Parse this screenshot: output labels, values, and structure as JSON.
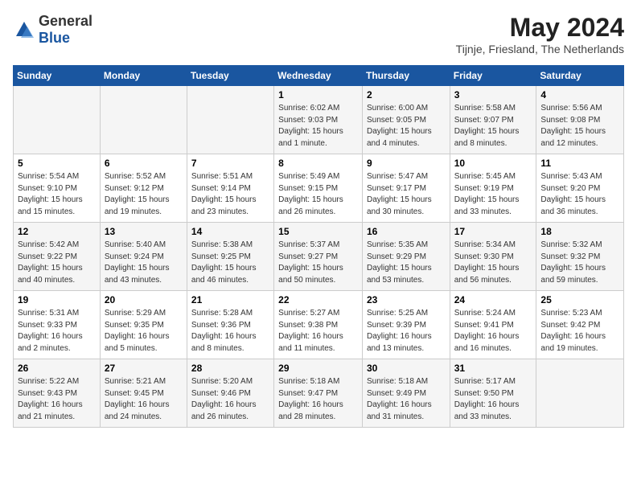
{
  "header": {
    "logo": {
      "general": "General",
      "blue": "Blue"
    },
    "month_year": "May 2024",
    "location": "Tijnje, Friesland, The Netherlands"
  },
  "calendar": {
    "days_of_week": [
      "Sunday",
      "Monday",
      "Tuesday",
      "Wednesday",
      "Thursday",
      "Friday",
      "Saturday"
    ],
    "weeks": [
      [
        {
          "day": "",
          "details": ""
        },
        {
          "day": "",
          "details": ""
        },
        {
          "day": "",
          "details": ""
        },
        {
          "day": "1",
          "details": "Sunrise: 6:02 AM\nSunset: 9:03 PM\nDaylight: 15 hours\nand 1 minute."
        },
        {
          "day": "2",
          "details": "Sunrise: 6:00 AM\nSunset: 9:05 PM\nDaylight: 15 hours\nand 4 minutes."
        },
        {
          "day": "3",
          "details": "Sunrise: 5:58 AM\nSunset: 9:07 PM\nDaylight: 15 hours\nand 8 minutes."
        },
        {
          "day": "4",
          "details": "Sunrise: 5:56 AM\nSunset: 9:08 PM\nDaylight: 15 hours\nand 12 minutes."
        }
      ],
      [
        {
          "day": "5",
          "details": "Sunrise: 5:54 AM\nSunset: 9:10 PM\nDaylight: 15 hours\nand 15 minutes."
        },
        {
          "day": "6",
          "details": "Sunrise: 5:52 AM\nSunset: 9:12 PM\nDaylight: 15 hours\nand 19 minutes."
        },
        {
          "day": "7",
          "details": "Sunrise: 5:51 AM\nSunset: 9:14 PM\nDaylight: 15 hours\nand 23 minutes."
        },
        {
          "day": "8",
          "details": "Sunrise: 5:49 AM\nSunset: 9:15 PM\nDaylight: 15 hours\nand 26 minutes."
        },
        {
          "day": "9",
          "details": "Sunrise: 5:47 AM\nSunset: 9:17 PM\nDaylight: 15 hours\nand 30 minutes."
        },
        {
          "day": "10",
          "details": "Sunrise: 5:45 AM\nSunset: 9:19 PM\nDaylight: 15 hours\nand 33 minutes."
        },
        {
          "day": "11",
          "details": "Sunrise: 5:43 AM\nSunset: 9:20 PM\nDaylight: 15 hours\nand 36 minutes."
        }
      ],
      [
        {
          "day": "12",
          "details": "Sunrise: 5:42 AM\nSunset: 9:22 PM\nDaylight: 15 hours\nand 40 minutes."
        },
        {
          "day": "13",
          "details": "Sunrise: 5:40 AM\nSunset: 9:24 PM\nDaylight: 15 hours\nand 43 minutes."
        },
        {
          "day": "14",
          "details": "Sunrise: 5:38 AM\nSunset: 9:25 PM\nDaylight: 15 hours\nand 46 minutes."
        },
        {
          "day": "15",
          "details": "Sunrise: 5:37 AM\nSunset: 9:27 PM\nDaylight: 15 hours\nand 50 minutes."
        },
        {
          "day": "16",
          "details": "Sunrise: 5:35 AM\nSunset: 9:29 PM\nDaylight: 15 hours\nand 53 minutes."
        },
        {
          "day": "17",
          "details": "Sunrise: 5:34 AM\nSunset: 9:30 PM\nDaylight: 15 hours\nand 56 minutes."
        },
        {
          "day": "18",
          "details": "Sunrise: 5:32 AM\nSunset: 9:32 PM\nDaylight: 15 hours\nand 59 minutes."
        }
      ],
      [
        {
          "day": "19",
          "details": "Sunrise: 5:31 AM\nSunset: 9:33 PM\nDaylight: 16 hours\nand 2 minutes."
        },
        {
          "day": "20",
          "details": "Sunrise: 5:29 AM\nSunset: 9:35 PM\nDaylight: 16 hours\nand 5 minutes."
        },
        {
          "day": "21",
          "details": "Sunrise: 5:28 AM\nSunset: 9:36 PM\nDaylight: 16 hours\nand 8 minutes."
        },
        {
          "day": "22",
          "details": "Sunrise: 5:27 AM\nSunset: 9:38 PM\nDaylight: 16 hours\nand 11 minutes."
        },
        {
          "day": "23",
          "details": "Sunrise: 5:25 AM\nSunset: 9:39 PM\nDaylight: 16 hours\nand 13 minutes."
        },
        {
          "day": "24",
          "details": "Sunrise: 5:24 AM\nSunset: 9:41 PM\nDaylight: 16 hours\nand 16 minutes."
        },
        {
          "day": "25",
          "details": "Sunrise: 5:23 AM\nSunset: 9:42 PM\nDaylight: 16 hours\nand 19 minutes."
        }
      ],
      [
        {
          "day": "26",
          "details": "Sunrise: 5:22 AM\nSunset: 9:43 PM\nDaylight: 16 hours\nand 21 minutes."
        },
        {
          "day": "27",
          "details": "Sunrise: 5:21 AM\nSunset: 9:45 PM\nDaylight: 16 hours\nand 24 minutes."
        },
        {
          "day": "28",
          "details": "Sunrise: 5:20 AM\nSunset: 9:46 PM\nDaylight: 16 hours\nand 26 minutes."
        },
        {
          "day": "29",
          "details": "Sunrise: 5:18 AM\nSunset: 9:47 PM\nDaylight: 16 hours\nand 28 minutes."
        },
        {
          "day": "30",
          "details": "Sunrise: 5:18 AM\nSunset: 9:49 PM\nDaylight: 16 hours\nand 31 minutes."
        },
        {
          "day": "31",
          "details": "Sunrise: 5:17 AM\nSunset: 9:50 PM\nDaylight: 16 hours\nand 33 minutes."
        },
        {
          "day": "",
          "details": ""
        }
      ]
    ]
  }
}
